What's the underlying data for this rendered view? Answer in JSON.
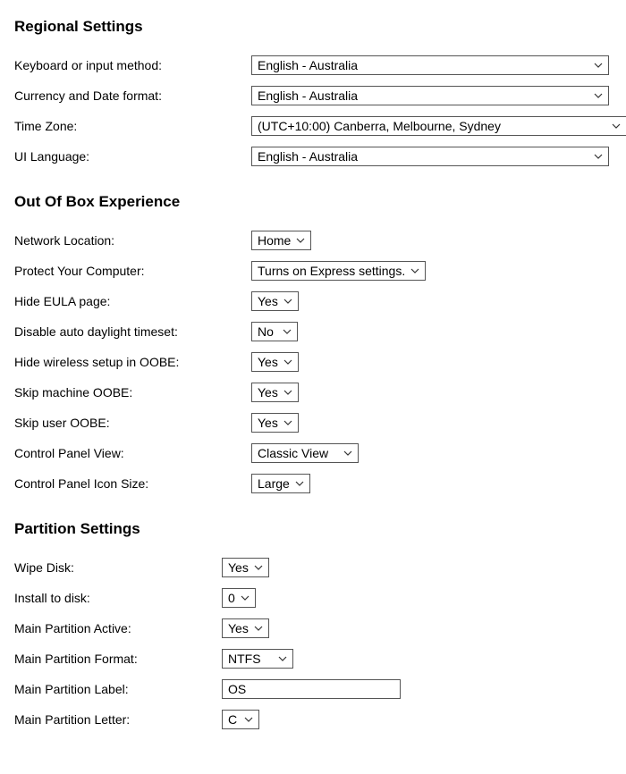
{
  "regional": {
    "heading": "Regional Settings",
    "keyboard_label": "Keyboard or input method:",
    "keyboard_value": "English - Australia",
    "currency_label": "Currency and Date format:",
    "currency_value": "English - Australia",
    "timezone_label": "Time Zone:",
    "timezone_value": "(UTC+10:00) Canberra, Melbourne, Sydney",
    "uilang_label": "UI Language:",
    "uilang_value": "English - Australia"
  },
  "oobe": {
    "heading": "Out Of Box Experience",
    "network_label": "Network Location:",
    "network_value": "Home",
    "protect_label": "Protect Your Computer:",
    "protect_value": "Turns on Express settings.",
    "hideeula_label": "Hide EULA page:",
    "hideeula_value": "Yes",
    "daylight_label": "Disable auto daylight timeset:",
    "daylight_value": "No",
    "hidewireless_label": "Hide wireless setup in OOBE:",
    "hidewireless_value": "Yes",
    "skipmachine_label": "Skip machine OOBE:",
    "skipmachine_value": "Yes",
    "skipuser_label": "Skip user OOBE:",
    "skipuser_value": "Yes",
    "cpanelview_label": "Control Panel View:",
    "cpanelview_value": "Classic View",
    "cpanelicon_label": "Control Panel Icon Size:",
    "cpanelicon_value": "Large"
  },
  "partition": {
    "heading": "Partition Settings",
    "wipedisk_label": "Wipe Disk:",
    "wipedisk_value": "Yes",
    "installdisk_label": "Install to disk:",
    "installdisk_value": "0",
    "mainactive_label": "Main Partition Active:",
    "mainactive_value": "Yes",
    "mainformat_label": "Main Partition Format:",
    "mainformat_value": "NTFS",
    "mainlabel_label": "Main Partition Label:",
    "mainlabel_value": "OS",
    "mainletter_label": "Main Partition Letter:",
    "mainletter_value": "C"
  }
}
